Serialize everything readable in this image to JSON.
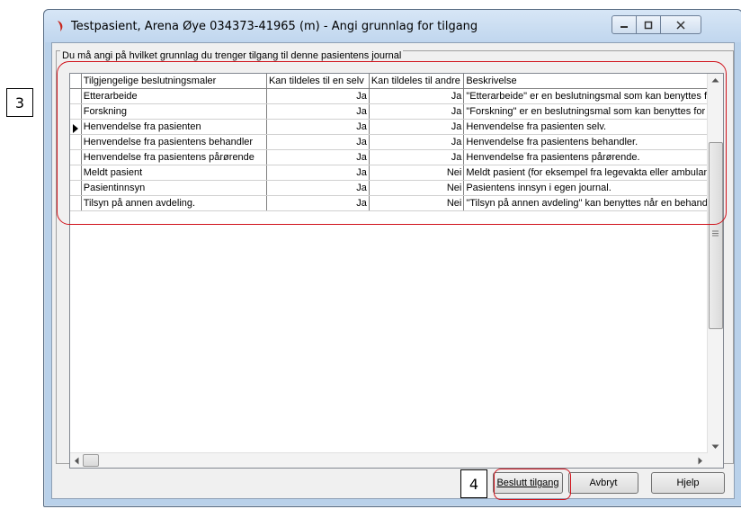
{
  "callouts": {
    "grid_number": "3",
    "button_number": "4"
  },
  "window": {
    "title": "Testpasient, Arena Øye  034373-41965 (m) - Angi grunnlag for tilgang"
  },
  "group": {
    "label": "Du må angi på hvilket grunnlag du trenger tilgang til denne pasientens journal"
  },
  "table": {
    "headers": [
      "Tilgjengelige beslutningsmaler",
      "Kan tildeles til en selv",
      "Kan tildeles til andre",
      "Beskrivelse"
    ],
    "rows": [
      {
        "template": "Etterarbeide",
        "self": "Ja",
        "others": "Ja",
        "desc": "\"Etterarbeide\" er en beslutningsmal som kan benyttes fo"
      },
      {
        "template": "Forskning",
        "self": "Ja",
        "others": "Ja",
        "desc": "\"Forskning\" er en beslutningsmal som kan benyttes for å"
      },
      {
        "template": "Henvendelse fra pasienten",
        "self": "Ja",
        "others": "Ja",
        "desc": "Henvendelse fra pasienten selv.",
        "current": true
      },
      {
        "template": "Henvendelse fra pasientens behandler",
        "self": "Ja",
        "others": "Ja",
        "desc": "Henvendelse fra pasientens behandler."
      },
      {
        "template": "Henvendelse fra pasientens pårørende",
        "self": "Ja",
        "others": "Ja",
        "desc": "Henvendelse fra pasientens pårørende."
      },
      {
        "template": "Meldt pasient",
        "self": "Ja",
        "others": "Nei",
        "desc": "Meldt pasient (for eksempel fra legevakta eller ambulans"
      },
      {
        "template": "Pasientinnsyn",
        "self": "Ja",
        "others": "Nei",
        "desc": "Pasientens innsyn i egen journal."
      },
      {
        "template": "Tilsyn på annen avdeling.",
        "self": "Ja",
        "others": "Nei",
        "desc": "\"Tilsyn på annen avdeling\" kan benyttes når en behand"
      }
    ]
  },
  "buttons": {
    "decide": "Beslutt tilgang",
    "cancel": "Avbryt",
    "help": "Hjelp"
  },
  "colors": {
    "highlight": "#d0121b",
    "window_frame": "#b9d1ea"
  }
}
